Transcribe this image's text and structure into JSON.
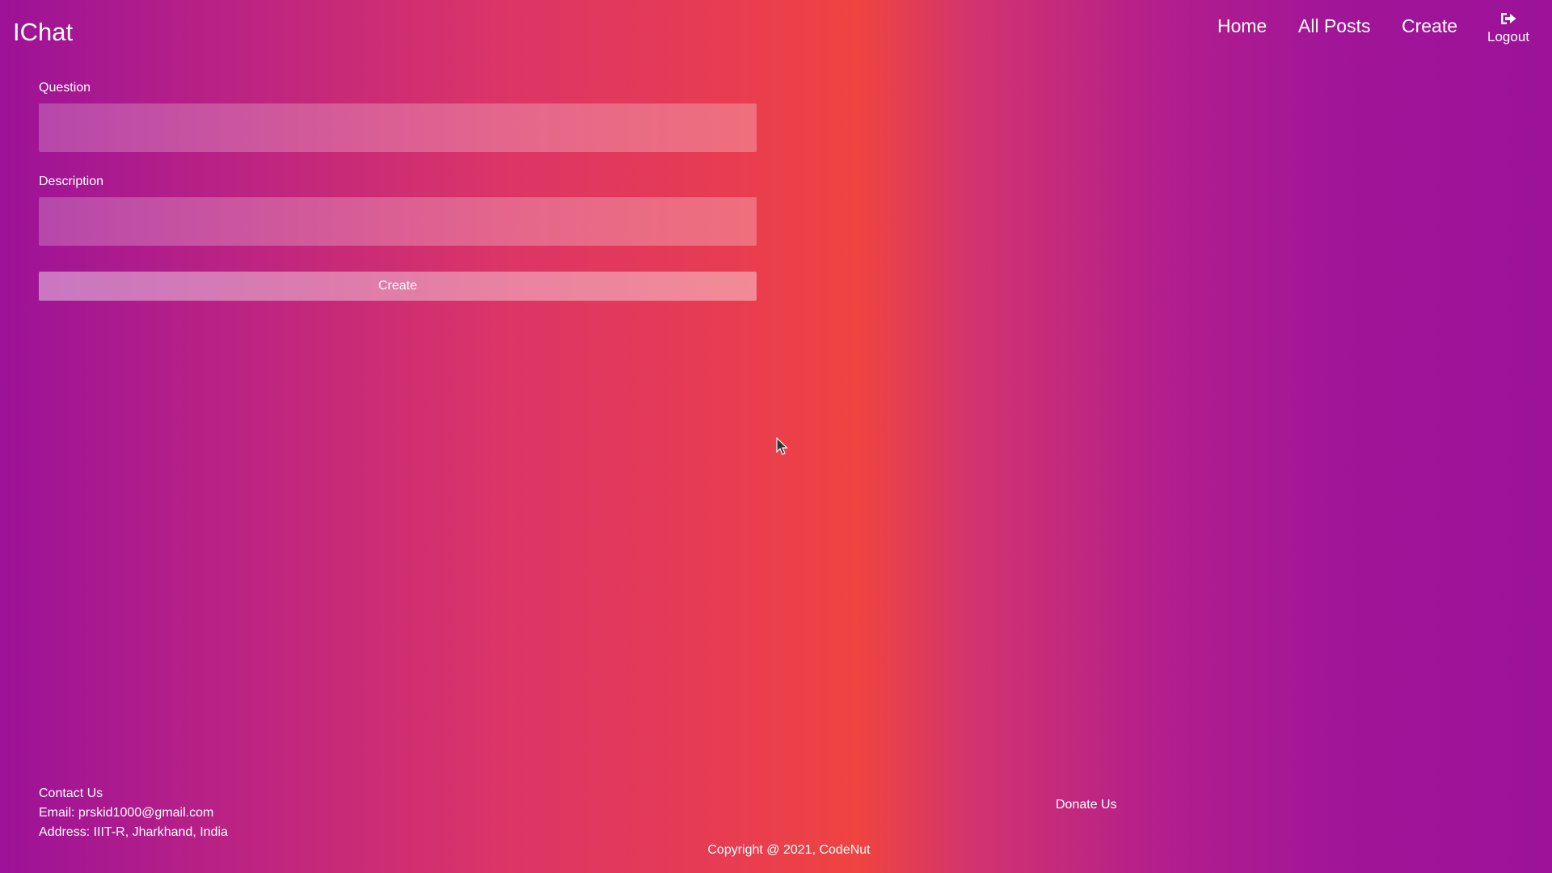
{
  "brand": "IChat",
  "nav": {
    "home": "Home",
    "all_posts": "All Posts",
    "create": "Create",
    "logout": "Logout",
    "logout_icon": "sign-out-icon"
  },
  "form": {
    "question_label": "Question",
    "question_value": "",
    "description_label": "Description",
    "description_value": "",
    "submit_label": "Create"
  },
  "footer": {
    "contact_heading": "Contact Us",
    "email": "Email: prskid1000@gmail.com",
    "address": "Address: IIIT-R, Jharkhand, India",
    "donate": "Donate Us",
    "copyright": "Copyright @ 2021, CodeNut"
  },
  "colors": {
    "gradient_edge": "#9c1298",
    "gradient_center": "#ef4440",
    "text": "#ffffff"
  }
}
